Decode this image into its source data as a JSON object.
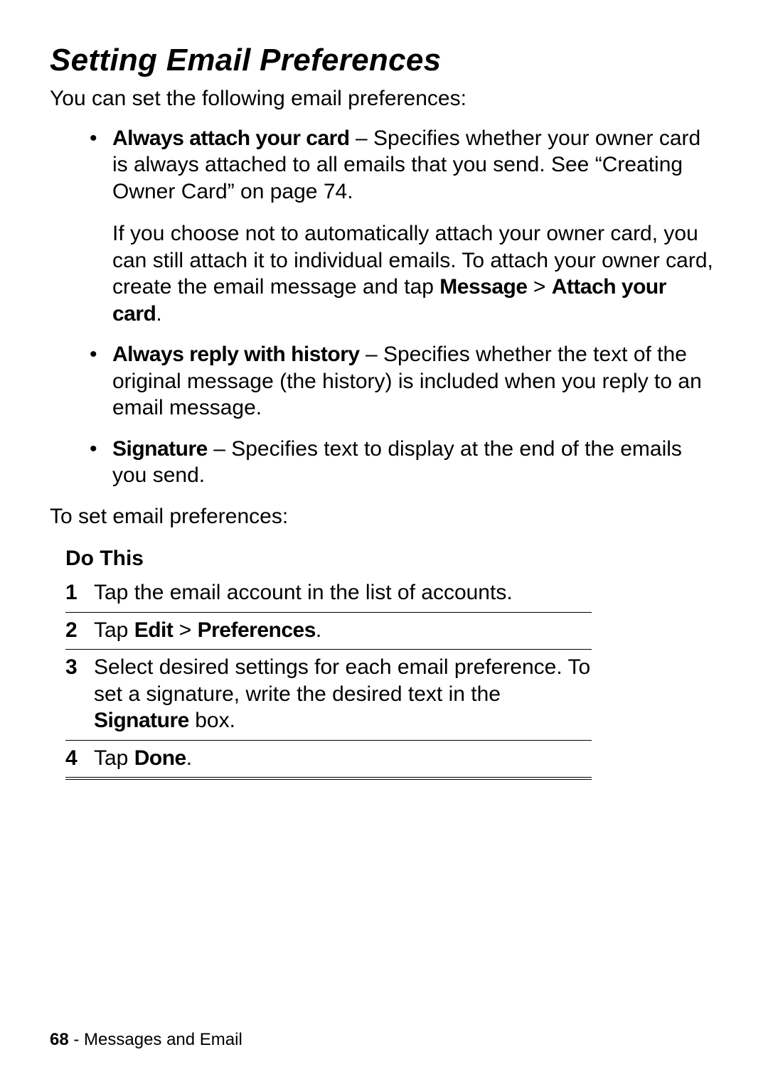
{
  "heading": "Setting Email Preferences",
  "intro": "You can set the following email preferences:",
  "bullets": {
    "b1": {
      "termA": "Always attach your card",
      "textA": " – Specifies whether your owner card is always attached to all emails that you send. See “Creating Owner Card” on page 74.",
      "textB_pre": "If you choose not to automatically attach your owner card, you can still attach it to individual emails. To attach your owner card, create the email message and tap ",
      "menu1": "Message",
      "sep": " > ",
      "menu2": "Attach your card",
      "textB_post": "."
    },
    "b2": {
      "term": "Always reply with history",
      "text": " – Specifies whether the text of the original message (the history) is included when you reply to an email message."
    },
    "b3": {
      "term": "Signature",
      "text": " – Specifies text to display at the end of the emails you send."
    }
  },
  "lead": "To set email preferences:",
  "steps": {
    "header": "Do This",
    "s1": {
      "num": "1",
      "text": "Tap the email account in the list of accounts."
    },
    "s2": {
      "num": "2",
      "pre": "Tap ",
      "m1": "Edit",
      "sep": " > ",
      "m2": "Preferences",
      "post": "."
    },
    "s3": {
      "num": "3",
      "pre": "Select desired settings for each email preference. To set a signature, write the desired text in the ",
      "term": "Signature",
      "post": " box."
    },
    "s4": {
      "num": "4",
      "pre": "Tap ",
      "term": "Done",
      "post": "."
    }
  },
  "footer": {
    "page": "68",
    "sep": " - ",
    "section": "Messages and Email"
  }
}
